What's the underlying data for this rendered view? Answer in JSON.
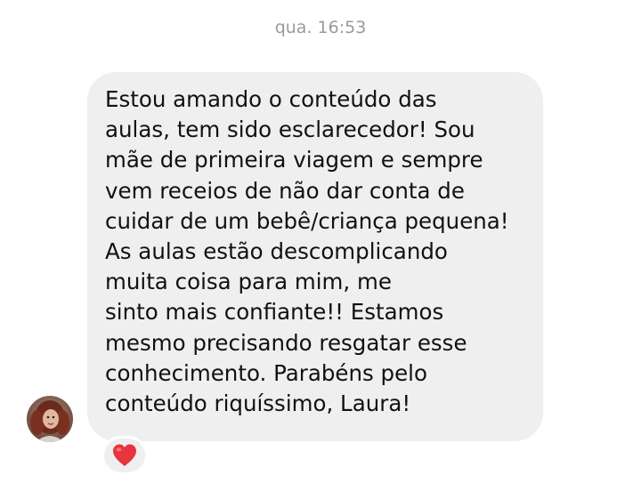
{
  "thread": {
    "timestamp": "qua. 16:53"
  },
  "message": {
    "lines": [
      "Estou amando o conteúdo das",
      "aulas, tem sido esclarecedor! Sou",
      "mãe de primeira viagem e sempre",
      "vem receios de não dar conta de",
      "cuidar de um bebê/criança pequena!",
      "As aulas estão descomplicando",
      "muita coisa para mim, me",
      "sinto mais confiante!! Estamos",
      "mesmo precisando resgatar esse",
      "conhecimento. Parabéns pelo",
      "conteúdo riquíssimo, Laura!"
    ],
    "bubble_color": "#efefef",
    "text_color": "#111111"
  },
  "sender": {
    "avatar_icon": "profile-photo"
  },
  "reaction": {
    "icon": "red-heart-icon",
    "color": "#e8343c"
  }
}
